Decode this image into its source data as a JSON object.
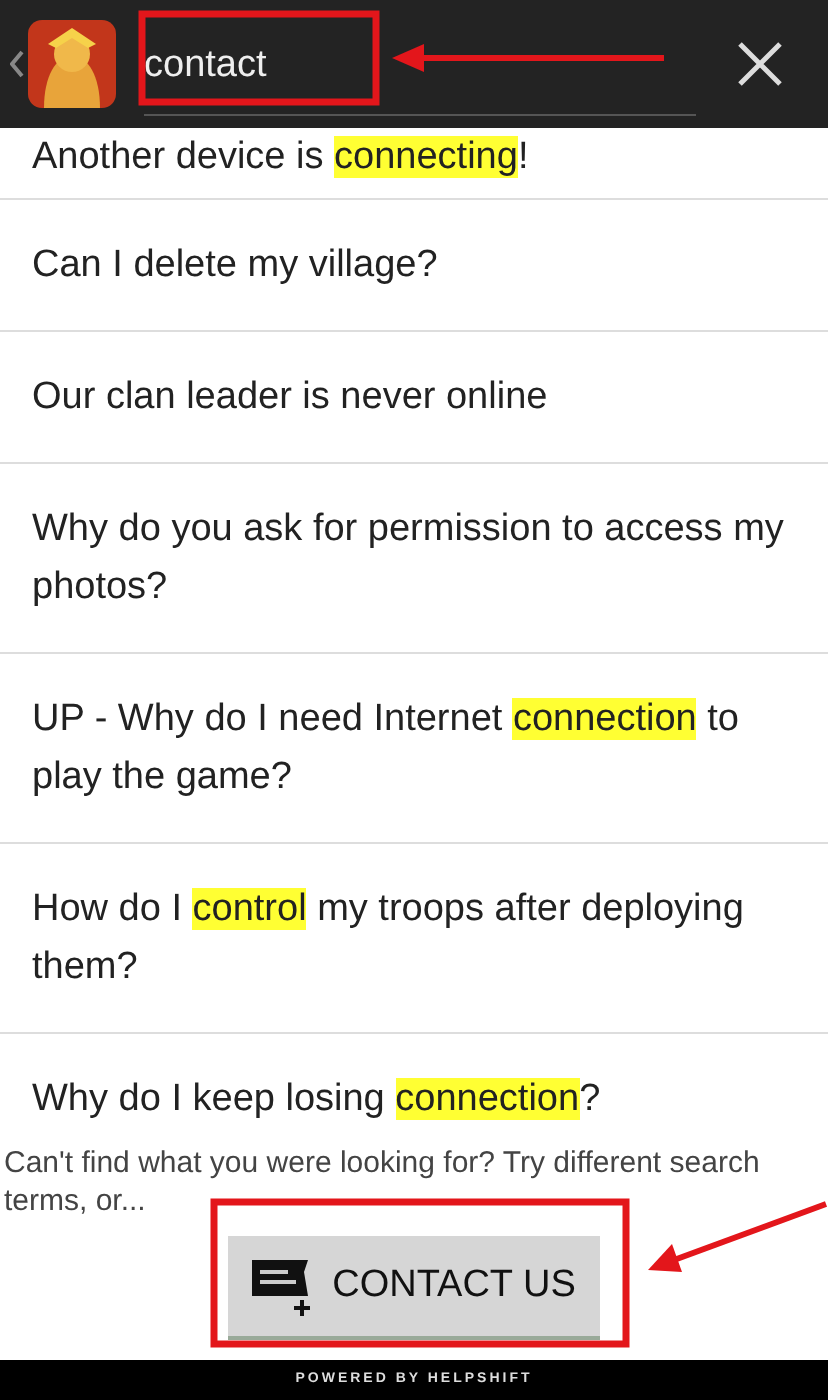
{
  "search": {
    "value": "contact"
  },
  "results": [
    {
      "parts": [
        {
          "text": "Another device is ",
          "highlight": false
        },
        {
          "text": "connecting",
          "highlight": true
        },
        {
          "text": "!",
          "highlight": false
        }
      ]
    },
    {
      "parts": [
        {
          "text": "Can I delete my village?",
          "highlight": false
        }
      ]
    },
    {
      "parts": [
        {
          "text": "Our clan leader is never online",
          "highlight": false
        }
      ]
    },
    {
      "parts": [
        {
          "text": "Why do you ask for permission to access my photos?",
          "highlight": false
        }
      ]
    },
    {
      "parts": [
        {
          "text": "UP - Why do I need Internet ",
          "highlight": false
        },
        {
          "text": "connection",
          "highlight": true
        },
        {
          "text": " to play the game?",
          "highlight": false
        }
      ]
    },
    {
      "parts": [
        {
          "text": "How do I ",
          "highlight": false
        },
        {
          "text": "control",
          "highlight": true
        },
        {
          "text": " my troops after deploying them?",
          "highlight": false
        }
      ]
    },
    {
      "parts": [
        {
          "text": "Why do I keep losing ",
          "highlight": false
        },
        {
          "text": "connection",
          "highlight": true
        },
        {
          "text": "?",
          "highlight": false
        }
      ]
    }
  ],
  "footer_text": "Can't find what you were looking for? Try different search terms, or...",
  "contact_button": "CONTACT US",
  "powered_by": "POWERED BY HELPSHIFT"
}
